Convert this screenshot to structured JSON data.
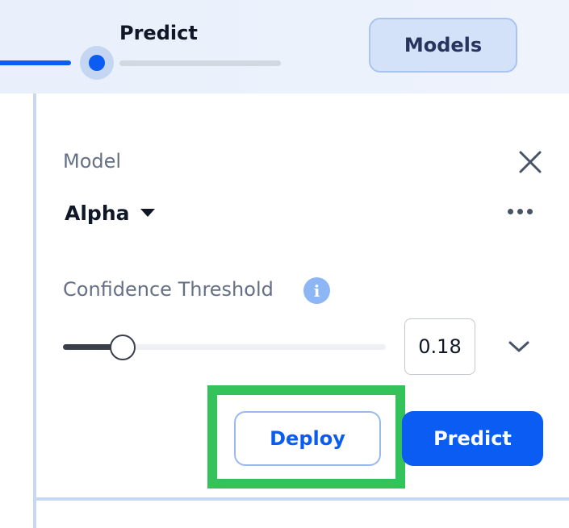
{
  "stepper": {
    "current_step": "Predict"
  },
  "header": {
    "models_label": "Models"
  },
  "panel": {
    "model_label": "Model",
    "model_value": "Alpha",
    "threshold_label": "Confidence Threshold",
    "info_glyph": "i",
    "threshold_value": "0.18",
    "threshold_fraction": 0.18,
    "deploy_label": "Deploy",
    "predict_label": "Predict"
  },
  "icons": {
    "close": "close-icon",
    "caret": "caret-down-icon",
    "more": "more-horizontal-icon",
    "info": "info-icon",
    "chevron": "chevron-down-icon"
  },
  "colors": {
    "accent": "#0a5cf2",
    "highlight": "#34c35a"
  }
}
